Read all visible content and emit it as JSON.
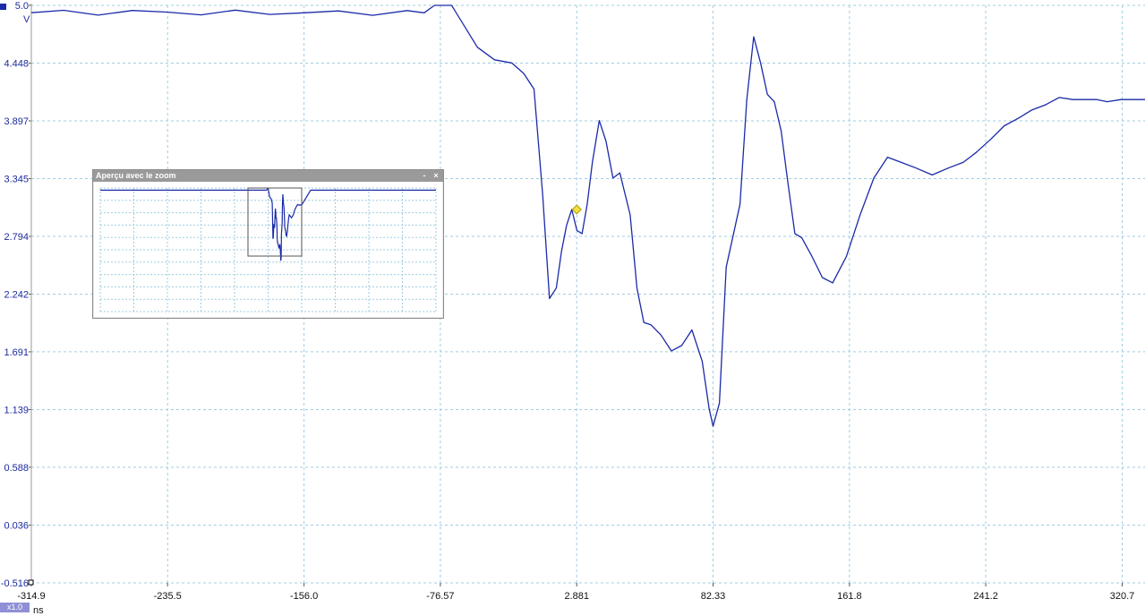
{
  "window": {
    "channel_color": "#1a2aa8",
    "zoom_factor": "x1.0"
  },
  "axes": {
    "y_unit": "V",
    "x_unit": "ns",
    "y_ticks": [
      "5.0",
      "4.448",
      "3.897",
      "3.345",
      "2.794",
      "2.242",
      "1.691",
      "1.139",
      "0.588",
      "0.036",
      "-0.516"
    ],
    "x_ticks": [
      "-314.9",
      "-235.5",
      "-156.0",
      "-76.57",
      "2.881",
      "82.33",
      "161.8",
      "241.2",
      "320.7"
    ]
  },
  "zoom_window": {
    "title": "Aperçu avec le zoom",
    "minimize_label": "-",
    "close_label": "×"
  },
  "chart_data": {
    "type": "line",
    "xlabel": "ns",
    "ylabel": "V",
    "xlim": [
      -314.9,
      334
    ],
    "ylim": [
      -0.516,
      5.0
    ],
    "grid": true,
    "trace_color": "#1a2aa8",
    "marker": {
      "x": 2.9,
      "y": 3.05,
      "color": "#f0e040"
    },
    "series": [
      {
        "x": [
          -314.9,
          -296,
          -276,
          -256,
          -236,
          -216,
          -196,
          -176,
          -156,
          -136,
          -116,
          -96,
          -86,
          -80,
          -74,
          -70,
          -55,
          -45,
          -35,
          -28,
          -22,
          -17,
          -13,
          -9,
          -6,
          -3,
          0,
          3,
          6,
          9,
          12,
          16,
          20,
          24,
          28,
          34,
          38,
          42,
          46,
          52,
          58,
          64,
          70,
          76,
          80,
          82.3,
          86,
          90,
          94,
          98,
          102,
          106,
          110,
          114,
          118,
          122,
          126,
          130,
          134,
          140,
          146,
          152,
          160,
          168,
          176,
          184,
          192,
          200,
          210,
          220,
          228,
          232,
          236,
          244,
          252,
          260,
          268,
          276,
          284,
          292,
          300,
          306,
          312,
          320,
          326,
          334
        ],
        "y": [
          4.93,
          4.93,
          4.93,
          4.94,
          4.93,
          4.93,
          4.93,
          4.93,
          4.93,
          4.93,
          4.93,
          4.93,
          4.95,
          5.0,
          5.0,
          5.0,
          4.6,
          4.48,
          4.45,
          4.35,
          4.2,
          3.2,
          2.2,
          2.3,
          2.65,
          2.9,
          3.05,
          2.85,
          2.82,
          3.1,
          3.5,
          3.9,
          3.7,
          3.35,
          3.4,
          3.0,
          2.3,
          1.97,
          1.95,
          1.85,
          1.7,
          1.75,
          1.9,
          1.6,
          1.15,
          0.98,
          1.2,
          2.5,
          2.8,
          3.1,
          4.1,
          4.7,
          4.45,
          4.15,
          4.08,
          3.8,
          3.3,
          2.82,
          2.78,
          2.6,
          2.4,
          2.35,
          2.6,
          3.0,
          3.35,
          3.55,
          3.5,
          3.45,
          3.38,
          3.45,
          3.5,
          3.55,
          3.6,
          3.72,
          3.85,
          3.92,
          4.0,
          4.05,
          4.12,
          4.1,
          4.1,
          4.1,
          4.08,
          4.1,
          4.1,
          4.1
        ]
      }
    ]
  }
}
